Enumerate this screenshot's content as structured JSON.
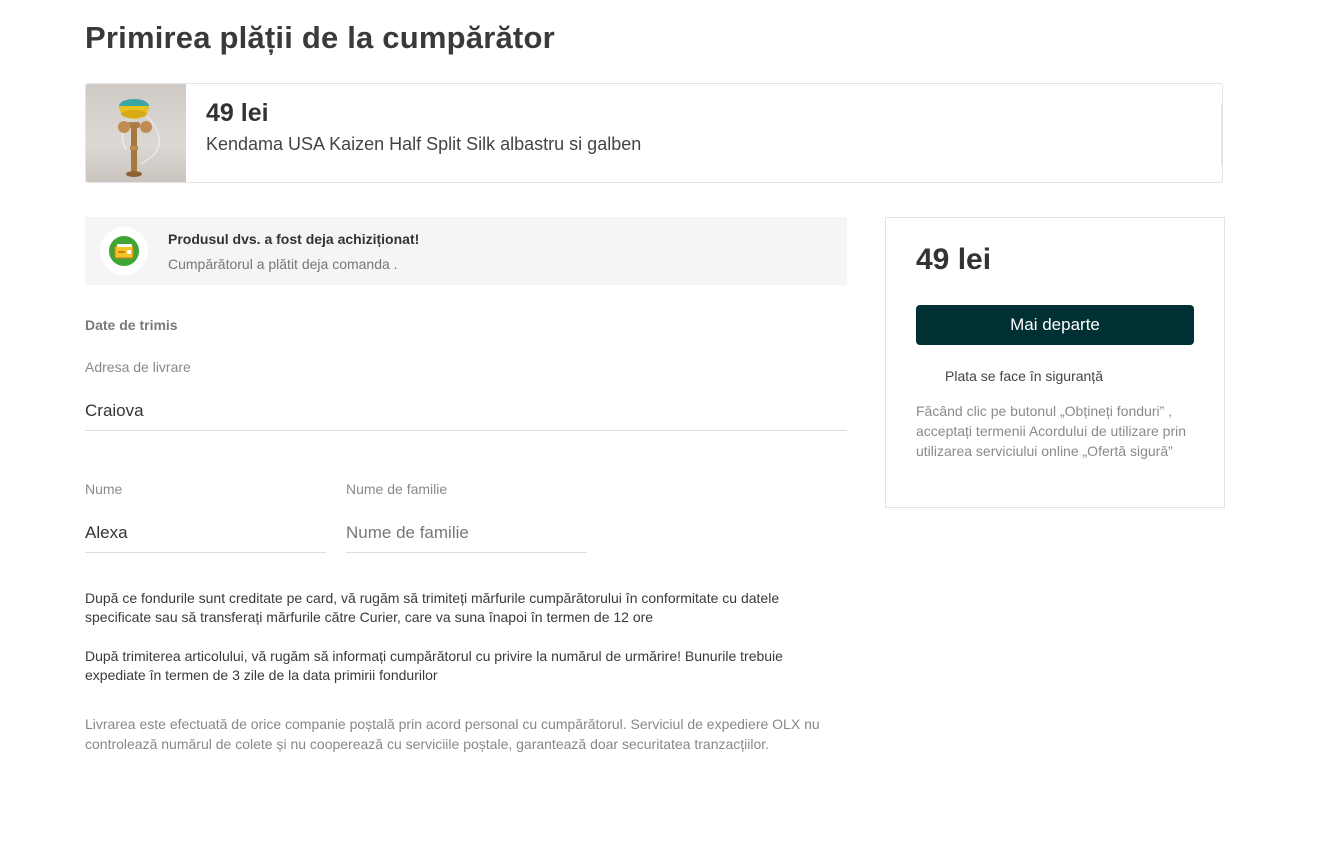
{
  "page": {
    "title": "Primirea plății de la cumpărător"
  },
  "product": {
    "price": "49 lei",
    "name": "Kendama USA Kaizen Half Split Silk albastru si galben",
    "thumbnail_icon": "kendama-photo"
  },
  "notice": {
    "icon": "payment-received-icon",
    "title": "Produsul dvs. a fost deja achiziționat!",
    "subtitle": "Cumpărătorul a plătit deja comanda ."
  },
  "shipping": {
    "section_heading": "Date de trimis",
    "address": {
      "label": "Adresa de livrare",
      "value": "Craiova"
    },
    "first_name": {
      "label": "Nume",
      "value": "Alexa"
    },
    "last_name": {
      "label": "Nume de familie",
      "value": "",
      "placeholder": "Nume de familie"
    }
  },
  "info": {
    "paragraph1": "După ce fondurile sunt creditate pe card, vă rugăm să trimiteți mărfurile cumpărătorului în conformitate cu datele specificate sau să transferați mărfurile către Curier, care va suna înapoi în termen de 12 ore",
    "paragraph2": "După trimiterea articolului, vă rugăm să informați cumpărătorul cu privire la numărul de urmărire! Bunurile trebuie expediate în termen de 3 zile de la data primirii fondurilor",
    "paragraph3": "Livrarea este efectuată de orice companie poștală prin acord personal cu cumpărătorul. Serviciul de expediere OLX nu controlează numărul de colete și nu cooperează cu serviciile poștale, garantează doar securitatea tranzacțiilor."
  },
  "summary": {
    "price": "49 lei",
    "continue_label": "Mai departe",
    "secure_label": "Plata se face în siguranță",
    "secure_icon": "shield-check-icon",
    "terms": "Făcând clic pe butonul „Obțineți fonduri” , acceptați termenii Acordului de utilizare prin utilizarea serviciului online „Ofertă sigură”"
  },
  "colors": {
    "button_bg": "#002f34",
    "notice_bg": "#f5f5f5",
    "notice_icon_green": "#3fa535"
  }
}
